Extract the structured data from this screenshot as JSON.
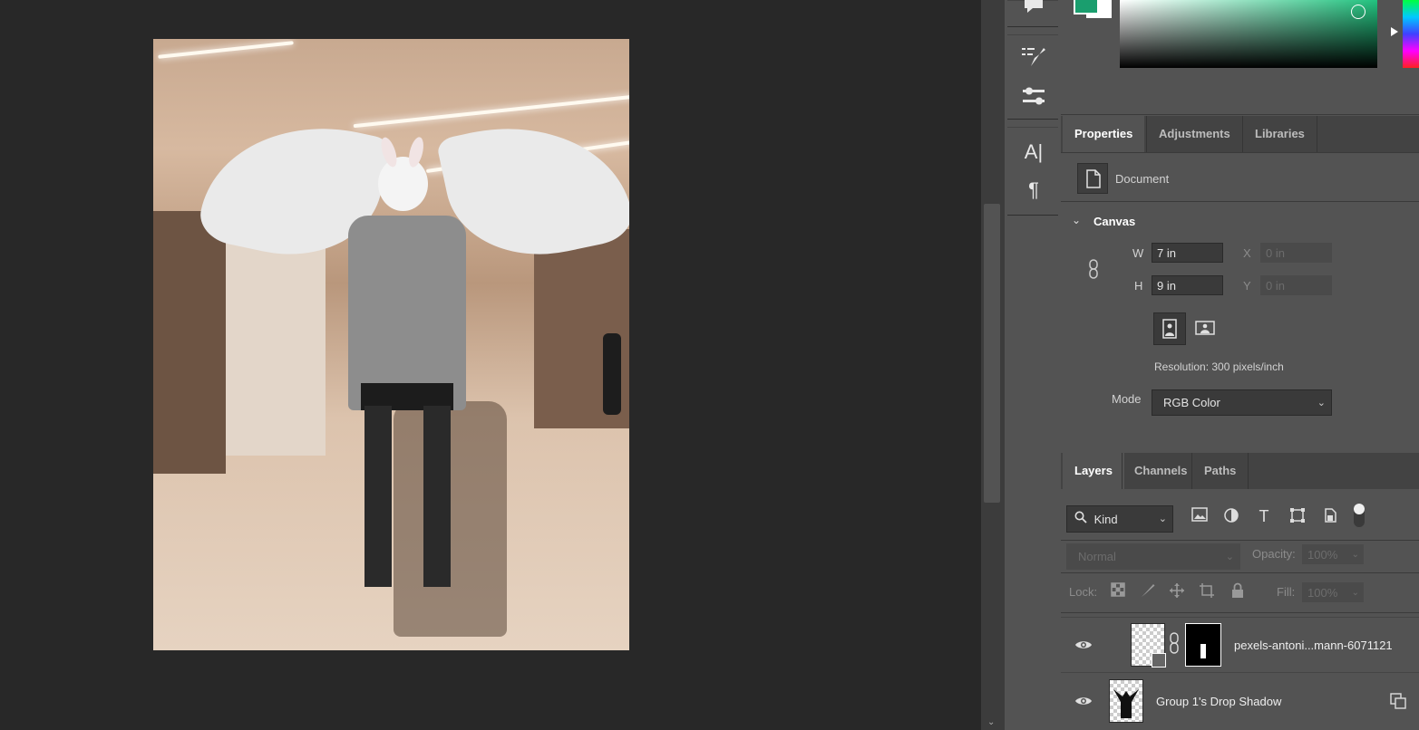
{
  "properties_tabs": [
    "Properties",
    "Adjustments",
    "Libraries"
  ],
  "document_label": "Document",
  "canvas_section": "Canvas",
  "canvas": {
    "w_label": "W",
    "w_value": "7 in",
    "h_label": "H",
    "h_value": "9 in",
    "x_label": "X",
    "x_placeholder": "0 in",
    "y_label": "Y",
    "y_placeholder": "0 in",
    "resolution": "Resolution: 300 pixels/inch",
    "mode_label": "Mode",
    "mode_value": "RGB Color"
  },
  "layers_tabs": [
    "Layers",
    "Channels",
    "Paths"
  ],
  "filter_kind": "Kind",
  "blend_mode": "Normal",
  "opacity_label": "Opacity:",
  "opacity_value": "100%",
  "lock_label": "Lock:",
  "fill_label": "Fill:",
  "fill_value": "100%",
  "layers": [
    {
      "name": "pexels-antoni...mann-6071121"
    },
    {
      "name": "Group 1's Drop Shadow"
    }
  ],
  "colors": {
    "foreground": "#1a9e6e",
    "background": "#ffffff",
    "accent": "#22c27f"
  }
}
